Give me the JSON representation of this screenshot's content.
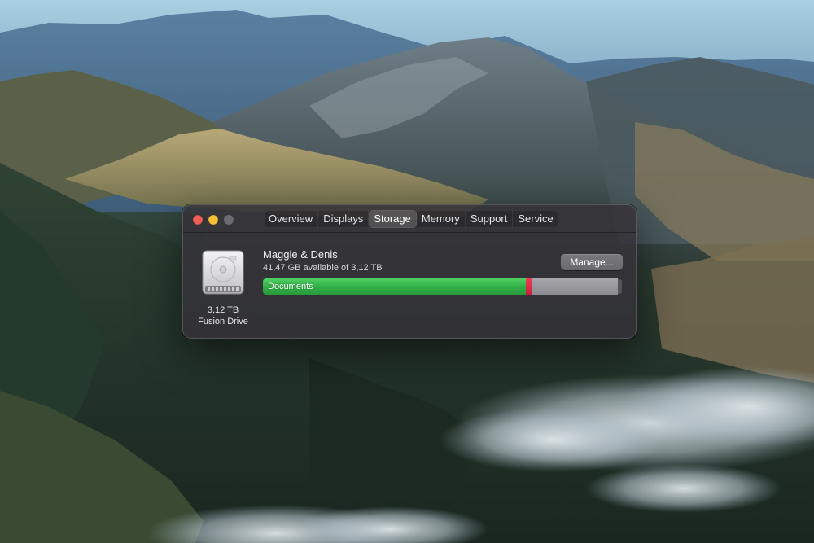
{
  "window": {
    "tabs": [
      {
        "label": "Overview",
        "active": false
      },
      {
        "label": "Displays",
        "active": false
      },
      {
        "label": "Storage",
        "active": true
      },
      {
        "label": "Memory",
        "active": false
      },
      {
        "label": "Support",
        "active": false
      },
      {
        "label": "Service",
        "active": false
      }
    ]
  },
  "storage": {
    "volume_name": "Maggie & Denis",
    "available_text": "41,47 GB available of 3,12 TB",
    "manage_label": "Manage...",
    "drive": {
      "capacity": "3,12 TB",
      "type": "Fusion Drive",
      "icon": "hard-drive-icon"
    },
    "usage_bar": {
      "segments": [
        {
          "name": "documents",
          "label": "Documents",
          "fraction": 0.73,
          "color": "#34b84a"
        },
        {
          "name": "other",
          "label": "",
          "fraction": 0.015,
          "color": "#d8243e"
        },
        {
          "name": "system",
          "label": "",
          "fraction": 0.24,
          "color": "#9b9a9f"
        }
      ]
    }
  },
  "colors": {
    "close": "#ee5f58",
    "minimize": "#f7be38",
    "zoom_disabled": "#6b6a70",
    "window_bg": "#343238",
    "accent_green": "#34b84a"
  }
}
